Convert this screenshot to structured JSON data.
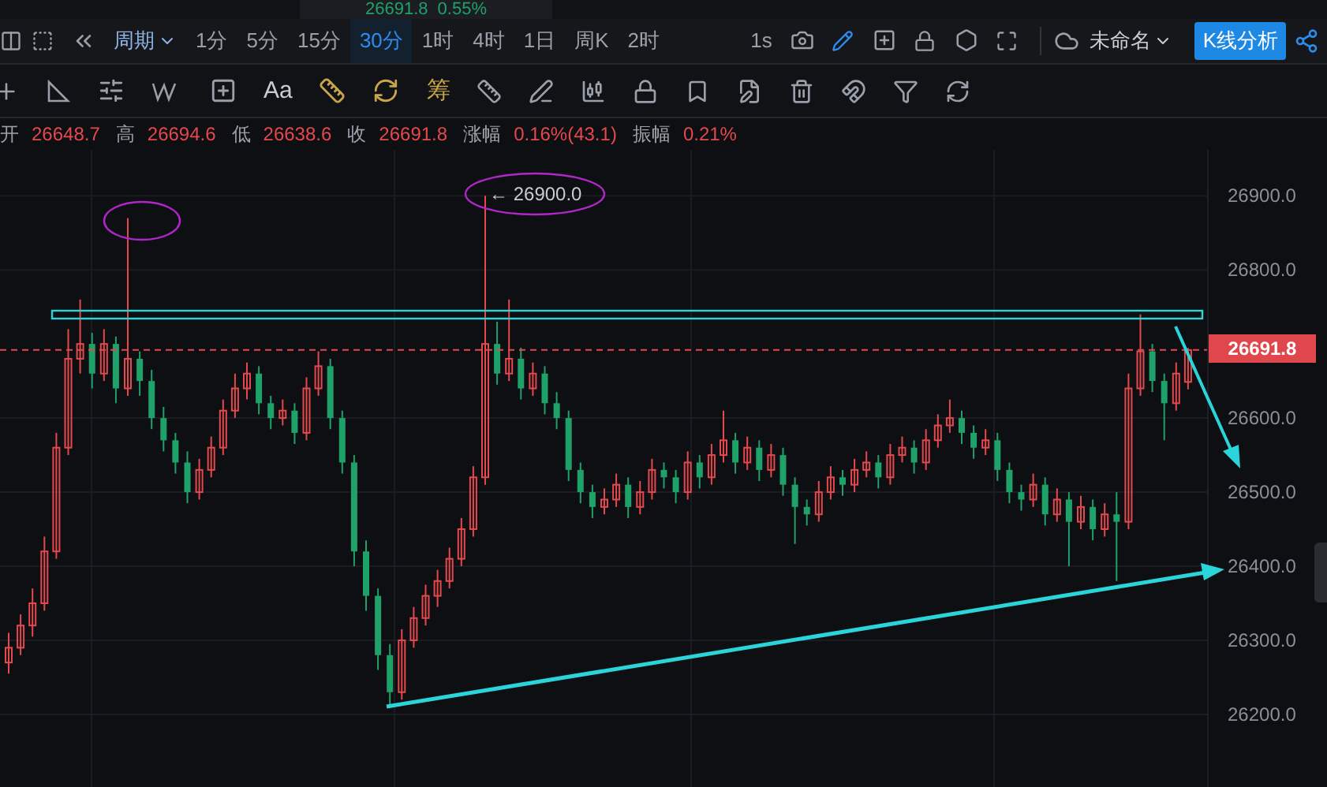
{
  "ticker_strip": [
    {
      "price": "26691.8",
      "change": "0.55%"
    }
  ],
  "toolbar": {
    "period_label": "周期",
    "periods": [
      {
        "label": "1分",
        "selected": false
      },
      {
        "label": "5分",
        "selected": false
      },
      {
        "label": "15分",
        "selected": false
      },
      {
        "label": "30分",
        "selected": true
      },
      {
        "label": "1时",
        "selected": false
      },
      {
        "label": "4时",
        "selected": false
      },
      {
        "label": "1日",
        "selected": false
      },
      {
        "label": "周K",
        "selected": false
      },
      {
        "label": "2时",
        "selected": false
      }
    ],
    "interval": "1s",
    "layout_name": "未命名",
    "analysis_button": "K线分析"
  },
  "drawing_tools": {
    "text_tool": "Aa",
    "chip_tool": "筹"
  },
  "ohlc": [
    {
      "label": "开",
      "value": "26648.7"
    },
    {
      "label": "高",
      "value": "26694.6"
    },
    {
      "label": "低",
      "value": "26638.6"
    },
    {
      "label": "收",
      "value": "26691.8"
    },
    {
      "label": "涨幅",
      "value": "0.16%(43.1)"
    },
    {
      "label": "振幅",
      "value": "0.21%"
    }
  ],
  "chart": {
    "annotation": {
      "arrow": "←",
      "price": "26900.0"
    },
    "chart_data": {
      "type": "candlestick",
      "grid": true,
      "ref_lines": [
        {
          "axis": "y",
          "value": 26691.8,
          "label": "26691.8"
        }
      ],
      "ylim": [
        26102,
        26962
      ],
      "yticks": [
        {
          "value": 26900,
          "label": "26900.0"
        },
        {
          "value": 26800,
          "label": "26800.0"
        },
        {
          "value": 26600,
          "label": "26600.0"
        },
        {
          "value": 26500,
          "label": "26500.0"
        },
        {
          "value": 26400,
          "label": "26400.0"
        },
        {
          "value": 26300,
          "label": "26300.0"
        },
        {
          "value": 26200,
          "label": "26200.0"
        }
      ],
      "ohlc": [
        [
          26270,
          26310,
          26255,
          26290
        ],
        [
          26290,
          26335,
          26280,
          26320
        ],
        [
          26320,
          26370,
          26305,
          26350
        ],
        [
          26350,
          26440,
          26340,
          26420
        ],
        [
          26420,
          26580,
          26410,
          26560
        ],
        [
          26560,
          26720,
          26550,
          26680
        ],
        [
          26680,
          26760,
          26660,
          26700
        ],
        [
          26700,
          26715,
          26640,
          26660
        ],
        [
          26660,
          26720,
          26650,
          26700
        ],
        [
          26700,
          26710,
          26620,
          26640
        ],
        [
          26640,
          26870,
          26630,
          26680
        ],
        [
          26680,
          26690,
          26630,
          26650
        ],
        [
          26650,
          26665,
          26585,
          26600
        ],
        [
          26600,
          26615,
          26555,
          26570
        ],
        [
          26570,
          26580,
          26525,
          26540
        ],
        [
          26540,
          26555,
          26485,
          26500
        ],
        [
          26500,
          26545,
          26490,
          26530
        ],
        [
          26530,
          26575,
          26520,
          26560
        ],
        [
          26560,
          26625,
          26550,
          26610
        ],
        [
          26610,
          26660,
          26600,
          26640
        ],
        [
          26640,
          26675,
          26625,
          26660
        ],
        [
          26660,
          26670,
          26605,
          26620
        ],
        [
          26620,
          26630,
          26585,
          26600
        ],
        [
          26600,
          26625,
          26590,
          26610
        ],
        [
          26610,
          26620,
          26565,
          26580
        ],
        [
          26580,
          26655,
          26570,
          26640
        ],
        [
          26640,
          26690,
          26630,
          26670
        ],
        [
          26670,
          26680,
          26585,
          26600
        ],
        [
          26600,
          26610,
          26525,
          26540
        ],
        [
          26540,
          26550,
          26400,
          26420
        ],
        [
          26420,
          26435,
          26340,
          26360
        ],
        [
          26360,
          26370,
          26260,
          26280
        ],
        [
          26280,
          26295,
          26210,
          26230
        ],
        [
          26230,
          26315,
          26220,
          26300
        ],
        [
          26300,
          26345,
          26290,
          26330
        ],
        [
          26330,
          26375,
          26320,
          26360
        ],
        [
          26360,
          26395,
          26345,
          26380
        ],
        [
          26380,
          26425,
          26370,
          26410
        ],
        [
          26410,
          26465,
          26400,
          26450
        ],
        [
          26450,
          26535,
          26440,
          26520
        ],
        [
          26520,
          26900,
          26510,
          26700
        ],
        [
          26700,
          26730,
          26645,
          26660
        ],
        [
          26660,
          26760,
          26650,
          26680
        ],
        [
          26680,
          26695,
          26625,
          26640
        ],
        [
          26640,
          26675,
          26630,
          26660
        ],
        [
          26660,
          26670,
          26605,
          26620
        ],
        [
          26620,
          26635,
          26585,
          26600
        ],
        [
          26600,
          26610,
          26515,
          26530
        ],
        [
          26530,
          26540,
          26485,
          26500
        ],
        [
          26500,
          26510,
          26465,
          26480
        ],
        [
          26480,
          26505,
          26470,
          26490
        ],
        [
          26490,
          26525,
          26480,
          26510
        ],
        [
          26510,
          26520,
          26465,
          26480
        ],
        [
          26480,
          26515,
          26470,
          26500
        ],
        [
          26500,
          26545,
          26490,
          26530
        ],
        [
          26530,
          26540,
          26505,
          26520
        ],
        [
          26520,
          26530,
          26485,
          26500
        ],
        [
          26500,
          26555,
          26490,
          26540
        ],
        [
          26540,
          26550,
          26505,
          26520
        ],
        [
          26520,
          26565,
          26510,
          26550
        ],
        [
          26550,
          26610,
          26540,
          26570
        ],
        [
          26570,
          26580,
          26525,
          26540
        ],
        [
          26540,
          26575,
          26530,
          26560
        ],
        [
          26560,
          26570,
          26515,
          26530
        ],
        [
          26530,
          26565,
          26520,
          26550
        ],
        [
          26550,
          26560,
          26495,
          26510
        ],
        [
          26510,
          26520,
          26430,
          26480
        ],
        [
          26480,
          26490,
          26455,
          26470
        ],
        [
          26470,
          26515,
          26460,
          26500
        ],
        [
          26500,
          26535,
          26490,
          26520
        ],
        [
          26520,
          26530,
          26495,
          26510
        ],
        [
          26510,
          26545,
          26500,
          26530
        ],
        [
          26530,
          26555,
          26520,
          26540
        ],
        [
          26540,
          26550,
          26505,
          26520
        ],
        [
          26520,
          26565,
          26510,
          26550
        ],
        [
          26550,
          26575,
          26540,
          26560
        ],
        [
          26560,
          26570,
          26525,
          26540
        ],
        [
          26540,
          26585,
          26530,
          26570
        ],
        [
          26570,
          26605,
          26560,
          26590
        ],
        [
          26590,
          26625,
          26580,
          26600
        ],
        [
          26600,
          26610,
          26565,
          26580
        ],
        [
          26580,
          26590,
          26545,
          26560
        ],
        [
          26560,
          26585,
          26550,
          26570
        ],
        [
          26570,
          26580,
          26515,
          26530
        ],
        [
          26530,
          26540,
          26485,
          26500
        ],
        [
          26500,
          26510,
          26475,
          26490
        ],
        [
          26490,
          26525,
          26480,
          26510
        ],
        [
          26510,
          26520,
          26455,
          26470
        ],
        [
          26470,
          26505,
          26460,
          26490
        ],
        [
          26490,
          26500,
          26400,
          26460
        ],
        [
          26460,
          26495,
          26450,
          26480
        ],
        [
          26480,
          26490,
          26435,
          26450
        ],
        [
          26450,
          26485,
          26440,
          26470
        ],
        [
          26470,
          26500,
          26380,
          26460
        ],
        [
          26460,
          26660,
          26450,
          26640
        ],
        [
          26640,
          26740,
          26630,
          26690
        ],
        [
          26690,
          26700,
          26635,
          26650
        ],
        [
          26650,
          26660,
          26570,
          26620
        ],
        [
          26620,
          26675,
          26610,
          26660
        ],
        [
          26648.7,
          26694.6,
          26638.6,
          26691.8
        ]
      ]
    }
  }
}
